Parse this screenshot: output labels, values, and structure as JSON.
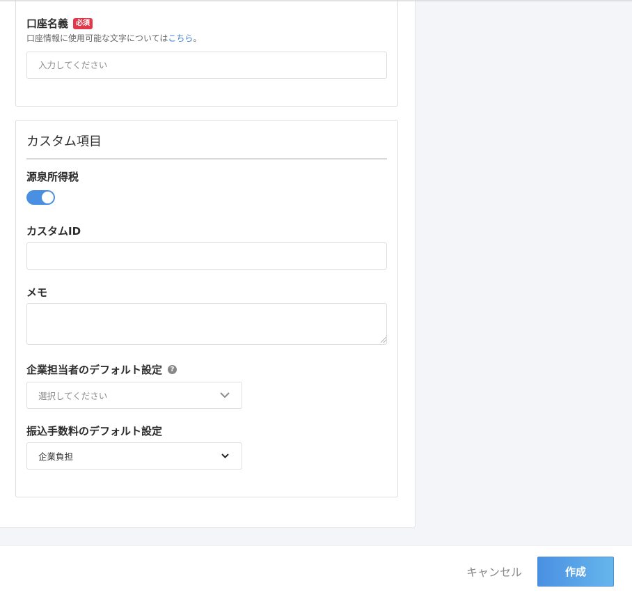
{
  "account_holder": {
    "label": "口座名義",
    "required_badge": "必須",
    "help_prefix": "口座情報に使用可能な文字については",
    "help_link": "こちら",
    "help_suffix": "。",
    "placeholder": "入力してください",
    "value": ""
  },
  "custom_section": {
    "title": "カスタム項目",
    "withholding_tax": {
      "label": "源泉所得税",
      "enabled": true
    },
    "custom_id": {
      "label": "カスタムID",
      "value": ""
    },
    "memo": {
      "label": "メモ",
      "value": ""
    },
    "default_contact": {
      "label": "企業担当者のデフォルト設定",
      "placeholder": "選択してください"
    },
    "default_transfer_fee": {
      "label": "振込手数料のデフォルト設定",
      "selected": "企業負担"
    }
  },
  "footer": {
    "cancel_label": "キャンセル",
    "create_label": "作成"
  },
  "colors": {
    "accent": "#4a90e2",
    "required_badge": "#e0394a",
    "link": "#3b7fd0"
  },
  "icons": {
    "help": "question-circle-icon",
    "chevron": "chevron-down-icon"
  }
}
